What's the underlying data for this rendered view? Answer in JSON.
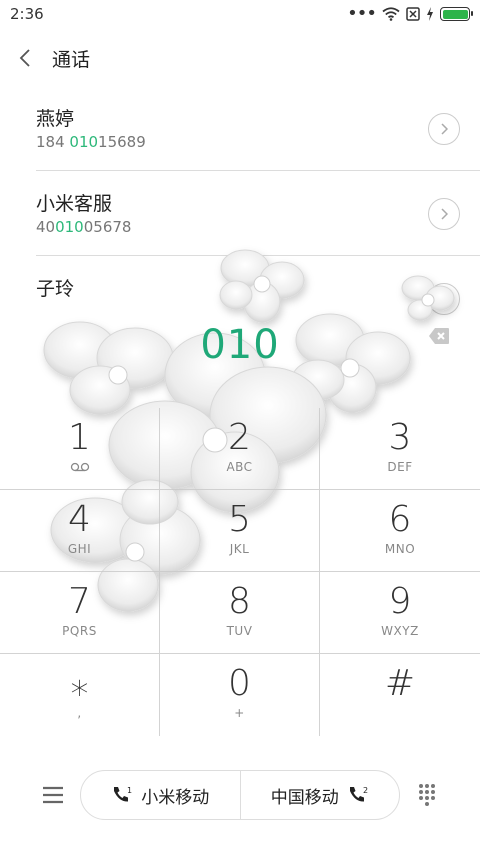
{
  "status_bar": {
    "time": "2:36",
    "battery_color": "#2db44a"
  },
  "header": {
    "title": "通话",
    "back_icon": "chevron-left-icon"
  },
  "contacts": [
    {
      "name": "燕婷",
      "number_pre": "184 ",
      "number_hl": "010",
      "number_post": "15689"
    },
    {
      "name": "小米客服",
      "number_pre": "40",
      "number_hl": "010",
      "number_post": "05678"
    },
    {
      "name": "子玲",
      "number_pre": "",
      "number_hl": "",
      "number_post": ""
    }
  ],
  "dialed_number": "010",
  "keys": [
    {
      "digit": "1",
      "sub": ""
    },
    {
      "digit": "2",
      "sub": "ABC"
    },
    {
      "digit": "3",
      "sub": "DEF"
    },
    {
      "digit": "4",
      "sub": "GHI"
    },
    {
      "digit": "5",
      "sub": "JKL"
    },
    {
      "digit": "6",
      "sub": "MNO"
    },
    {
      "digit": "7",
      "sub": "PQRS"
    },
    {
      "digit": "8",
      "sub": "TUV"
    },
    {
      "digit": "9",
      "sub": "WXYZ"
    },
    {
      "digit": "⁎",
      "sub": ","
    },
    {
      "digit": "0",
      "sub": "+"
    },
    {
      "digit": "#",
      "sub": ""
    }
  ],
  "bottom": {
    "sim1_label": "小米移动",
    "sim2_label": "中国移动",
    "sim1_index": "1",
    "sim2_index": "2"
  },
  "colors": {
    "accent": "#1fa878",
    "highlight": "#2db87a"
  }
}
